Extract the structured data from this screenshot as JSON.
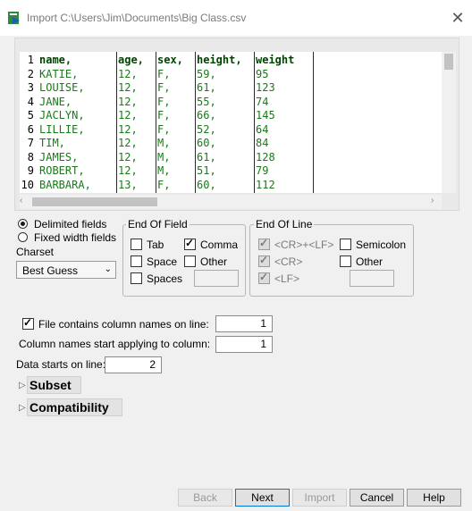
{
  "window": {
    "title": "Import C:\\Users\\Jim\\Documents\\Big Class.csv",
    "close_glyph": "✕",
    "icon": "import-icon"
  },
  "preview": {
    "columns": [
      "name,",
      "age,",
      "sex,",
      "height,",
      "weight"
    ],
    "rows": [
      {
        "ln": "1",
        "cells": [
          "name,",
          "age,",
          "sex,",
          "height,",
          "weight"
        ]
      },
      {
        "ln": "2",
        "cells": [
          "KATIE,",
          "12,",
          "F,",
          "59,",
          "95"
        ]
      },
      {
        "ln": "3",
        "cells": [
          "LOUISE,",
          "12,",
          "F,",
          "61,",
          "123"
        ]
      },
      {
        "ln": "4",
        "cells": [
          "JANE,",
          "12,",
          "F,",
          "55,",
          "74"
        ]
      },
      {
        "ln": "5",
        "cells": [
          "JACLYN,",
          "12,",
          "F,",
          "66,",
          "145"
        ]
      },
      {
        "ln": "6",
        "cells": [
          "LILLIE,",
          "12,",
          "F,",
          "52,",
          "64"
        ]
      },
      {
        "ln": "7",
        "cells": [
          "TIM,",
          "12,",
          "M,",
          "60,",
          "84"
        ]
      },
      {
        "ln": "8",
        "cells": [
          "JAMES,",
          "12,",
          "M,",
          "61,",
          "128"
        ]
      },
      {
        "ln": "9",
        "cells": [
          "ROBERT,",
          "12,",
          "M,",
          "51,",
          "79"
        ]
      },
      {
        "ln": "10",
        "cells": [
          "BARBARA,",
          "13,",
          "F,",
          "60,",
          "112"
        ]
      }
    ]
  },
  "field_mode": {
    "delimited": "Delimited fields",
    "fixed": "Fixed width fields",
    "selected": "delimited"
  },
  "charset": {
    "label": "Charset",
    "value": "Best Guess"
  },
  "end_of_field": {
    "title": "End Of Field",
    "tab": "Tab",
    "comma": "Comma",
    "space": "Space",
    "other": "Other",
    "spaces": "Spaces",
    "other_value": ""
  },
  "end_of_line": {
    "title": "End Of Line",
    "crlf": "<CR>+<LF>",
    "semicolon": "Semicolon",
    "cr": "<CR>",
    "other": "Other",
    "lf": "<LF>",
    "other_value": ""
  },
  "options": {
    "col_names_label": "File contains column names on line:",
    "col_names_value": "1",
    "col_start_label": "Column names start applying to column:",
    "col_start_value": "1",
    "data_start_label": "Data starts on line:",
    "data_start_value": "2"
  },
  "sections": {
    "subset": "Subset",
    "compat": "Compatibility"
  },
  "buttons": {
    "back": "Back",
    "next": "Next",
    "import": "Import",
    "cancel": "Cancel",
    "help": "Help"
  }
}
